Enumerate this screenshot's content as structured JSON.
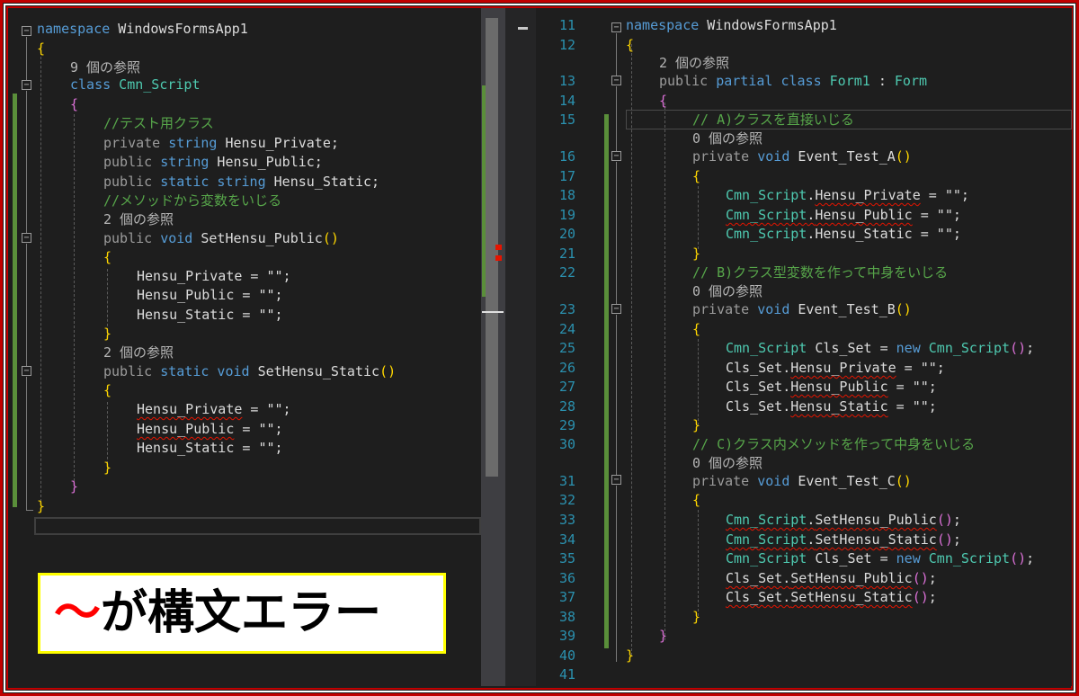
{
  "left": {
    "lines": [
      [
        "namespace",
        " WindowsFormsApp1"
      ],
      [
        "{"
      ],
      [
        "9 個の参照"
      ],
      [
        "class",
        " Cmn_Script"
      ],
      [
        "{"
      ],
      [
        "//テスト用クラス"
      ],
      [
        "private",
        " string",
        " Hensu_Private;"
      ],
      [
        "public",
        " string",
        " Hensu_Public;"
      ],
      [
        "public",
        " static",
        " string",
        " Hensu_Static;"
      ],
      [
        "//メソッドから変数をいじる"
      ],
      [
        "2 個の参照"
      ],
      [
        "public",
        " void",
        " SetHensu_Public",
        "(",
        ")"
      ],
      [
        "{"
      ],
      [
        "Hensu_Private = \"\";"
      ],
      [
        "Hensu_Public = \"\";"
      ],
      [
        "Hensu_Static = \"\";"
      ],
      [
        "}"
      ],
      [
        "2 個の参照"
      ],
      [
        "public",
        " static",
        " void",
        " SetHensu_Static",
        "(",
        ")"
      ],
      [
        "{"
      ],
      [
        "Hensu_Private",
        " = \"\";"
      ],
      [
        "Hensu_Public",
        " = \"\";"
      ],
      [
        "Hensu_Static = \"\";"
      ],
      [
        "}"
      ],
      [
        "}"
      ],
      [
        "}"
      ]
    ]
  },
  "right": {
    "line_numbers": [
      "11",
      "12",
      "13",
      "14",
      "15",
      "16",
      "17",
      "18",
      "19",
      "20",
      "21",
      "22",
      "23",
      "24",
      "25",
      "26",
      "27",
      "28",
      "29",
      "30",
      "31",
      "32",
      "33",
      "34",
      "35",
      "36",
      "37",
      "38",
      "39",
      "40",
      "41"
    ],
    "lines": [
      [
        "namespace",
        " WindowsFormsApp1"
      ],
      [
        "{"
      ],
      [
        "2 個の参照"
      ],
      [
        "public",
        " partial",
        " class",
        " Form1",
        " : ",
        "Form"
      ],
      [
        "{"
      ],
      [
        "// A)クラスを直接いじる"
      ],
      [
        "0 個の参照"
      ],
      [
        "private",
        " void",
        " Event_Test_A",
        "()"
      ],
      [
        "{"
      ],
      [
        "Cmn_Script",
        ".",
        "Hensu_Private",
        " = \"\";"
      ],
      [
        "Cmn_Script",
        ".",
        "Hensu_Public",
        " = \"\";"
      ],
      [
        "Cmn_Script",
        ".",
        "Hensu_Static",
        " = \"\";"
      ],
      [
        "}"
      ],
      [
        "// B)クラス型変数を作って中身をいじる"
      ],
      [
        "0 個の参照"
      ],
      [
        "private",
        " void",
        " Event_Test_B",
        "()"
      ],
      [
        "{"
      ],
      [
        "Cmn_Script",
        " Cls_Set = ",
        "new",
        " Cmn_Script",
        "()",
        ";"
      ],
      [
        "Cls_Set.",
        "Hensu_Private",
        " = \"\";"
      ],
      [
        "Cls_Set.",
        "Hensu_Public",
        " = \"\";"
      ],
      [
        "Cls_Set.",
        "Hensu_Static",
        " = \"\";"
      ],
      [
        "}"
      ],
      [
        "// C)クラス内メソッドを作って中身をいじる"
      ],
      [
        "0 個の参照"
      ],
      [
        "private",
        " void",
        " Event_Test_C",
        "()"
      ],
      [
        "{"
      ],
      [
        "Cmn_Script",
        ".",
        "SetHensu_Public",
        "()",
        ";"
      ],
      [
        "Cmn_Script",
        ".",
        "SetHensu_Static",
        "()",
        ";"
      ],
      [
        "Cmn_Script",
        " Cls_Set = ",
        "new",
        " Cmn_Script",
        "()",
        ";"
      ],
      [
        "Cls_Set.",
        "SetHensu_Public",
        "()",
        ";"
      ],
      [
        "Cls_Set.",
        "SetHensu_Static",
        "()",
        ";"
      ],
      [
        "}"
      ],
      [
        "}"
      ],
      [
        "}"
      ]
    ]
  },
  "callout": {
    "tilde": "～",
    "text": "が構文エラー"
  },
  "colors": {
    "border": "#c00000",
    "callout_border": "#ffff00",
    "error": "#e51400"
  },
  "icons": {
    "fold": "collapse-minus-icon"
  }
}
